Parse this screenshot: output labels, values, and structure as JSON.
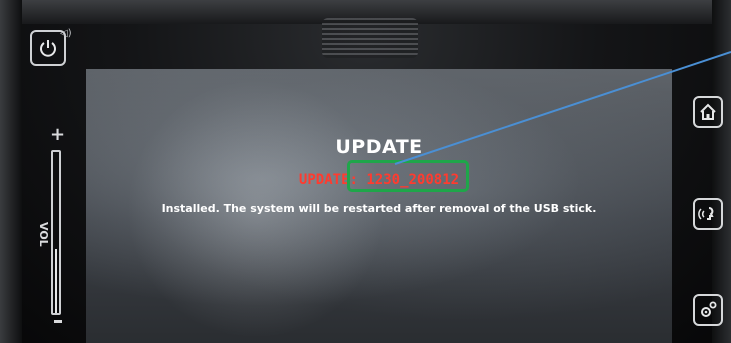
{
  "screen": {
    "title": "UPDATE",
    "update_line": "UPDATE: 1230_200812",
    "status_message": "Installed. The system will be restarted after removal of the USB stick."
  },
  "controls": {
    "power_icon": "power-icon",
    "volume": {
      "label": "VOL",
      "plus": "+",
      "level": 0.4
    }
  },
  "side_keys": [
    {
      "icon": "home-icon"
    },
    {
      "icon": "voice-icon"
    },
    {
      "icon": "settings-icon"
    }
  ],
  "annotation": {
    "highlight_color": "#1fa64a",
    "arrow_color": "#4a8fd4"
  },
  "colors": {
    "update_text": "#ff3b2f",
    "screen_text": "#ffffff"
  }
}
